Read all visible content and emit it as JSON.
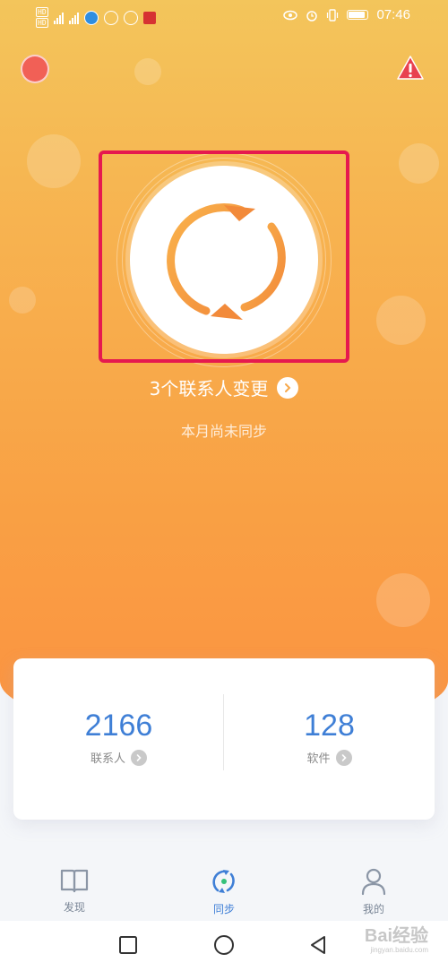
{
  "status_bar": {
    "left_chips": [
      "HD",
      "HD"
    ],
    "signal_labels": [
      "4G",
      "4G"
    ],
    "time": "07:46"
  },
  "top_bar": {
    "avatar_color": "#f16056",
    "warning_color": "#e8414f"
  },
  "sync_panel": {
    "changes_text": "3个联系人变更",
    "status_text": "本月尚未同步",
    "accent_colors": [
      "#f9a94a",
      "#f28a3a"
    ]
  },
  "stats": {
    "contacts": {
      "value": "2166",
      "label": "联系人"
    },
    "apps": {
      "value": "128",
      "label": "软件"
    }
  },
  "bottom_nav": {
    "items": [
      {
        "label": "发现",
        "icon": "book-icon",
        "active": false
      },
      {
        "label": "同步",
        "icon": "sync-icon",
        "active": true
      },
      {
        "label": "我的",
        "icon": "person-icon",
        "active": false
      }
    ],
    "active_color": "#3f7fd6",
    "inactive_color": "#7a8696"
  },
  "system_nav": {
    "buttons": [
      "square-icon",
      "circle-icon",
      "back-triangle-icon"
    ]
  },
  "watermark": {
    "main": "Bai经验",
    "sub": "jingyan.baidu.com"
  }
}
